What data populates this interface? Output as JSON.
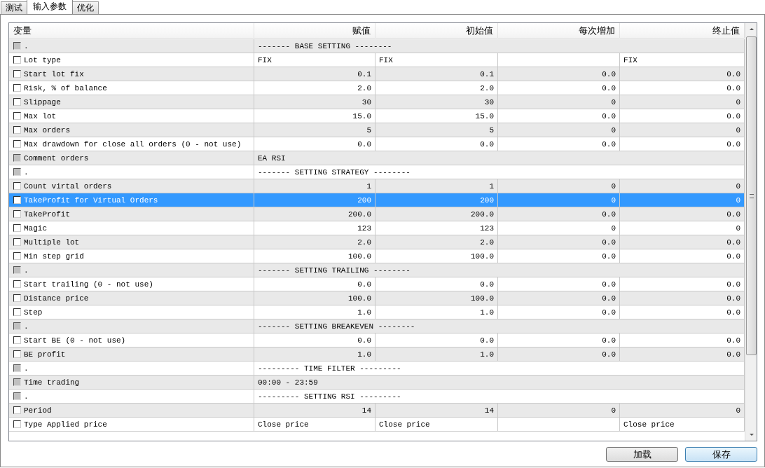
{
  "tabs": [
    {
      "label": "测试",
      "selected": false
    },
    {
      "label": "输入参数",
      "selected": true
    },
    {
      "label": "优化",
      "selected": false
    }
  ],
  "table": {
    "columns": [
      "变量",
      "赋值",
      "初始值",
      "每次增加",
      "终止值"
    ],
    "rows": [
      {
        "kind": "span",
        "name": ".",
        "checked": false,
        "disabled": true,
        "selected": false,
        "value": "------- BASE SETTING --------"
      },
      {
        "kind": "choice",
        "name": "Lot type",
        "checked": false,
        "disabled": false,
        "selected": false,
        "cells": [
          "FIX",
          "FIX",
          "",
          "FIX"
        ]
      },
      {
        "kind": "number",
        "name": "Start lot fix",
        "checked": false,
        "disabled": false,
        "selected": false,
        "cells": [
          "0.1",
          "0.1",
          "0.0",
          "0.0"
        ]
      },
      {
        "kind": "number",
        "name": "Risk, % of balance",
        "checked": false,
        "disabled": false,
        "selected": false,
        "cells": [
          "2.0",
          "2.0",
          "0.0",
          "0.0"
        ]
      },
      {
        "kind": "number",
        "name": "Slippage",
        "checked": false,
        "disabled": false,
        "selected": false,
        "cells": [
          "30",
          "30",
          "0",
          "0"
        ]
      },
      {
        "kind": "number",
        "name": "Max lot",
        "checked": false,
        "disabled": false,
        "selected": false,
        "cells": [
          "15.0",
          "15.0",
          "0.0",
          "0.0"
        ]
      },
      {
        "kind": "number",
        "name": "Max orders",
        "checked": false,
        "disabled": false,
        "selected": false,
        "cells": [
          "5",
          "5",
          "0",
          "0"
        ]
      },
      {
        "kind": "number",
        "name": "Max drawdown for close all orders (0 - not use)",
        "checked": false,
        "disabled": false,
        "selected": false,
        "cells": [
          "0.0",
          "0.0",
          "0.0",
          "0.0"
        ]
      },
      {
        "kind": "span",
        "name": "Comment orders",
        "checked": false,
        "disabled": true,
        "selected": false,
        "value": "EA RSI"
      },
      {
        "kind": "span",
        "name": ".",
        "checked": false,
        "disabled": true,
        "selected": false,
        "value": "------- SETTING STRATEGY --------"
      },
      {
        "kind": "number",
        "name": "Count virtal orders",
        "checked": false,
        "disabled": false,
        "selected": false,
        "cells": [
          "1",
          "1",
          "0",
          "0"
        ]
      },
      {
        "kind": "number",
        "name": "TakeProfit for Virtual Orders",
        "checked": false,
        "disabled": false,
        "selected": true,
        "cells": [
          "200",
          "200",
          "0",
          "0"
        ]
      },
      {
        "kind": "number",
        "name": "TakeProfit",
        "checked": false,
        "disabled": false,
        "selected": false,
        "cells": [
          "200.0",
          "200.0",
          "0.0",
          "0.0"
        ]
      },
      {
        "kind": "number",
        "name": "Magic",
        "checked": false,
        "disabled": false,
        "selected": false,
        "cells": [
          "123",
          "123",
          "0",
          "0"
        ]
      },
      {
        "kind": "number",
        "name": "Multiple lot",
        "checked": false,
        "disabled": false,
        "selected": false,
        "cells": [
          "2.0",
          "2.0",
          "0.0",
          "0.0"
        ]
      },
      {
        "kind": "number",
        "name": "Min step grid",
        "checked": false,
        "disabled": false,
        "selected": false,
        "cells": [
          "100.0",
          "100.0",
          "0.0",
          "0.0"
        ]
      },
      {
        "kind": "span",
        "name": ".",
        "checked": false,
        "disabled": true,
        "selected": false,
        "value": "------- SETTING TRAILING --------"
      },
      {
        "kind": "number",
        "name": "Start trailing (0 - not use)",
        "checked": false,
        "disabled": false,
        "selected": false,
        "cells": [
          "0.0",
          "0.0",
          "0.0",
          "0.0"
        ]
      },
      {
        "kind": "number",
        "name": "Distance price",
        "checked": false,
        "disabled": false,
        "selected": false,
        "cells": [
          "100.0",
          "100.0",
          "0.0",
          "0.0"
        ]
      },
      {
        "kind": "number",
        "name": "Step",
        "checked": false,
        "disabled": false,
        "selected": false,
        "cells": [
          "1.0",
          "1.0",
          "0.0",
          "0.0"
        ]
      },
      {
        "kind": "span",
        "name": ".",
        "checked": false,
        "disabled": true,
        "selected": false,
        "value": "------- SETTING BREAKEVEN --------"
      },
      {
        "kind": "number",
        "name": "Start BE (0 - not use)",
        "checked": false,
        "disabled": false,
        "selected": false,
        "cells": [
          "0.0",
          "0.0",
          "0.0",
          "0.0"
        ]
      },
      {
        "kind": "number",
        "name": "BE profit",
        "checked": false,
        "disabled": false,
        "selected": false,
        "cells": [
          "1.0",
          "1.0",
          "0.0",
          "0.0"
        ]
      },
      {
        "kind": "span",
        "name": ".",
        "checked": false,
        "disabled": true,
        "selected": false,
        "value": "--------- TIME FILTER ---------"
      },
      {
        "kind": "span",
        "name": "Time trading",
        "checked": false,
        "disabled": true,
        "selected": false,
        "value": "00:00 - 23:59"
      },
      {
        "kind": "span",
        "name": ".",
        "checked": false,
        "disabled": true,
        "selected": false,
        "value": "--------- SETTING RSI ---------"
      },
      {
        "kind": "number",
        "name": "Period",
        "checked": false,
        "disabled": false,
        "selected": false,
        "cells": [
          "14",
          "14",
          "0",
          "0"
        ]
      },
      {
        "kind": "choice",
        "name": "Type Applied price",
        "checked": false,
        "disabled": false,
        "selected": false,
        "cells": [
          "Close price",
          "Close price",
          "",
          "Close price"
        ]
      }
    ]
  },
  "buttons": [
    "加载",
    "保存"
  ]
}
